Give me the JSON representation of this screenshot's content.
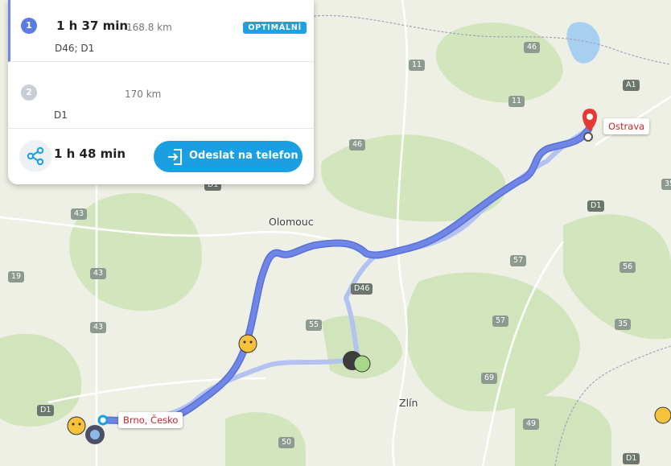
{
  "routes": [
    {
      "index": "1",
      "duration": "1 h 37 min",
      "distance": "168.8 km",
      "roads": "D46; D1",
      "badge": "OPTIMÁLNÍ"
    },
    {
      "index": "2",
      "duration": "1 h 48 min",
      "distance": "170 km",
      "roads": "D1"
    }
  ],
  "actions": {
    "share_icon": "share-icon",
    "send_label": "Odeslat na telefon",
    "send_icon": "send-to-phone-icon"
  },
  "map": {
    "destination_label": "Ostrava",
    "origin_label": "Brno, Česko",
    "cities": [
      "Olomouc",
      "Zlín",
      "Brno",
      "Ostrava"
    ],
    "road_numbers": [
      "11",
      "11",
      "46",
      "46",
      "43",
      "43",
      "43",
      "19",
      "55",
      "57",
      "57",
      "69",
      "49",
      "50",
      "35",
      "35",
      "56",
      "A1",
      "D1",
      "D1",
      "D1",
      "D1",
      "D46"
    ],
    "colors": {
      "main_route": "#6f86e6",
      "alt_route": "#b3c2f0",
      "pin": "#e53935"
    }
  }
}
